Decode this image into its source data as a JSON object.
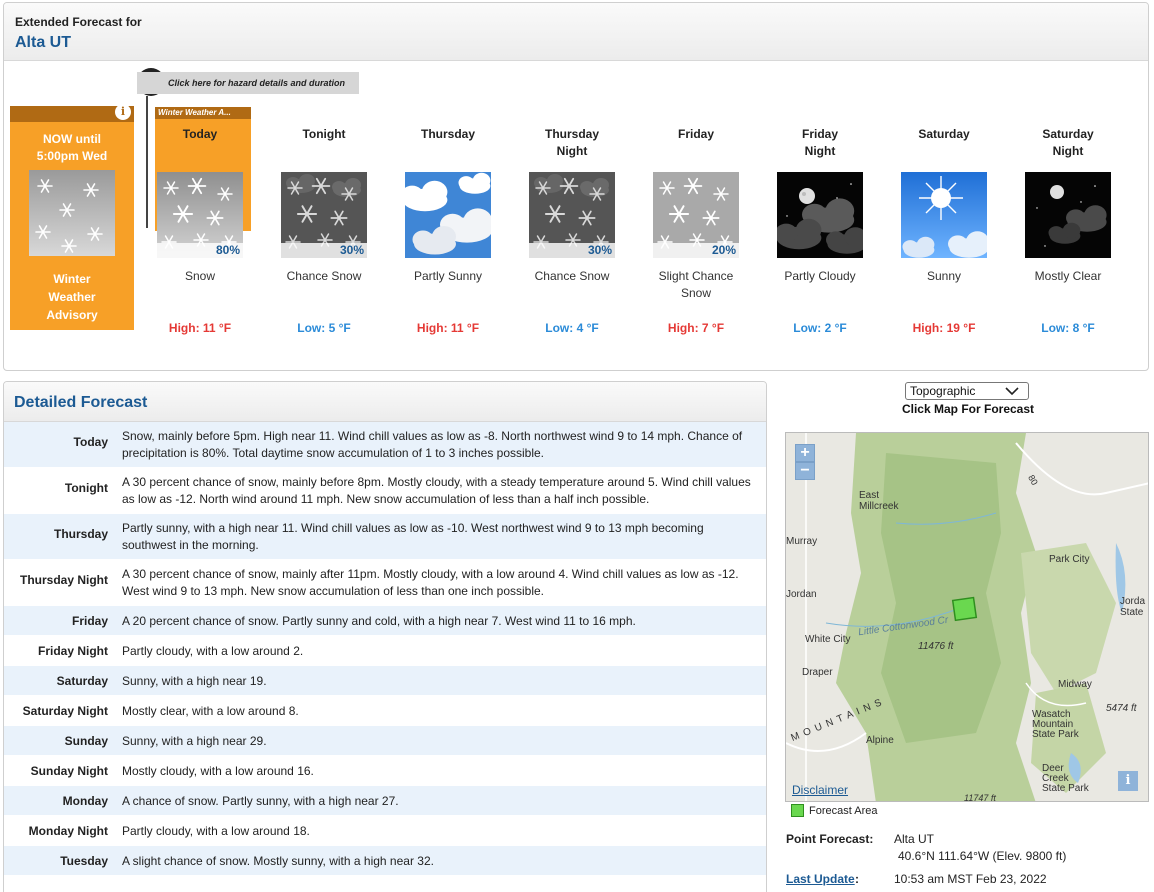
{
  "header": {
    "subtitle": "Extended Forecast for",
    "location": "Alta UT"
  },
  "hazard": {
    "prompt": "Click here for hazard details and duration",
    "today_tab": "Winter Weather A..."
  },
  "now": {
    "title": "NOW until\n5:00pm Wed",
    "description": "Winter\nWeather\nAdvisory"
  },
  "tombstones": [
    {
      "period": "Today",
      "icon": "snow-icon",
      "pop": "80%",
      "desc": "Snow",
      "temp": "High: 11 °F",
      "kind": "high"
    },
    {
      "period": "Tonight",
      "icon": "chance-snow-night-icon",
      "pop": "30%",
      "desc": "Chance Snow",
      "temp": "Low: 5 °F",
      "kind": "low"
    },
    {
      "period": "Thursday",
      "icon": "partly-sunny-icon",
      "pop": "",
      "desc": "Partly Sunny",
      "temp": "High: 11 °F",
      "kind": "high"
    },
    {
      "period": "Thursday\nNight",
      "icon": "chance-snow-night-icon",
      "pop": "30%",
      "desc": "Chance Snow",
      "temp": "Low: 4 °F",
      "kind": "low"
    },
    {
      "period": "Friday",
      "icon": "slight-chance-snow-icon",
      "pop": "20%",
      "desc": "Slight Chance\nSnow",
      "temp": "High: 7 °F",
      "kind": "high"
    },
    {
      "period": "Friday\nNight",
      "icon": "partly-cloudy-night-icon",
      "pop": "",
      "desc": "Partly Cloudy",
      "temp": "Low: 2 °F",
      "kind": "low"
    },
    {
      "period": "Saturday",
      "icon": "sunny-icon",
      "pop": "",
      "desc": "Sunny",
      "temp": "High: 19 °F",
      "kind": "high"
    },
    {
      "period": "Saturday\nNight",
      "icon": "mostly-clear-night-icon",
      "pop": "",
      "desc": "Mostly Clear",
      "temp": "Low: 8 °F",
      "kind": "low"
    }
  ],
  "detailed": {
    "title": "Detailed Forecast",
    "rows": [
      {
        "label": "Today",
        "text": "Snow, mainly before 5pm. High near 11. Wind chill values as low as -8. North northwest wind 9 to 14 mph. Chance of precipitation is 80%. Total daytime snow accumulation of 1 to 3 inches possible."
      },
      {
        "label": "Tonight",
        "text": "A 30 percent chance of snow, mainly before 8pm. Mostly cloudy, with a steady temperature around 5. Wind chill values as low as -12. North wind around 11 mph. New snow accumulation of less than a half inch possible."
      },
      {
        "label": "Thursday",
        "text": "Partly sunny, with a high near 11. Wind chill values as low as -10. West northwest wind 9 to 13 mph becoming southwest in the morning."
      },
      {
        "label": "Thursday Night",
        "text": "A 30 percent chance of snow, mainly after 11pm. Mostly cloudy, with a low around 4. Wind chill values as low as -12. West wind 9 to 13 mph. New snow accumulation of less than one inch possible."
      },
      {
        "label": "Friday",
        "text": "A 20 percent chance of snow. Partly sunny and cold, with a high near 7. West wind 11 to 16 mph."
      },
      {
        "label": "Friday Night",
        "text": "Partly cloudy, with a low around 2."
      },
      {
        "label": "Saturday",
        "text": "Sunny, with a high near 19."
      },
      {
        "label": "Saturday Night",
        "text": "Mostly clear, with a low around 8."
      },
      {
        "label": "Sunday",
        "text": "Sunny, with a high near 29."
      },
      {
        "label": "Sunday Night",
        "text": "Mostly cloudy, with a low around 16."
      },
      {
        "label": "Monday",
        "text": "A chance of snow. Partly sunny, with a high near 27."
      },
      {
        "label": "Monday Night",
        "text": "Partly cloudy, with a low around 18."
      },
      {
        "label": "Tuesday",
        "text": "A slight chance of snow. Mostly sunny, with a high near 32."
      }
    ]
  },
  "map": {
    "select_value": "Topographic",
    "hint": "Click Map For Forecast",
    "zoom_in": "+",
    "zoom_out": "−",
    "disclaimer": "Disclaimer",
    "legend": "Forecast Area",
    "labels": {
      "east_millcreek": "East\nMillcreek",
      "murray": "Murray",
      "park_city": "Park City",
      "jordan": "Jordan",
      "jordanelle": "Jorda\nState",
      "little_cottonwood": "Little Cottonwood Cr",
      "white_city": "White City",
      "elev_11476": "11476 ft",
      "draper": "Draper",
      "midway": "Midway",
      "elev_5474": "5474 ft",
      "wasatch": "Wasatch\nMountain\nState Park",
      "mountains": "M O U N T A I N S",
      "alpine": "Alpine",
      "deer_creek": "Deer\nCreek\nState Park",
      "hwy_80": "80",
      "elev_11747": "11747 ft"
    }
  },
  "point": {
    "label": "Point Forecast:",
    "value": "Alta UT",
    "coords": "40.6°N 111.64°W (Elev. 9800 ft)",
    "update_label": "Last Update",
    "update_colon": ":",
    "update_value": "10:53 am MST Feb 23, 2022"
  },
  "colors": {
    "accent": "#1c5a93",
    "advisory": "#f7a027",
    "high": "#e53935",
    "low": "#2b8bd8"
  }
}
